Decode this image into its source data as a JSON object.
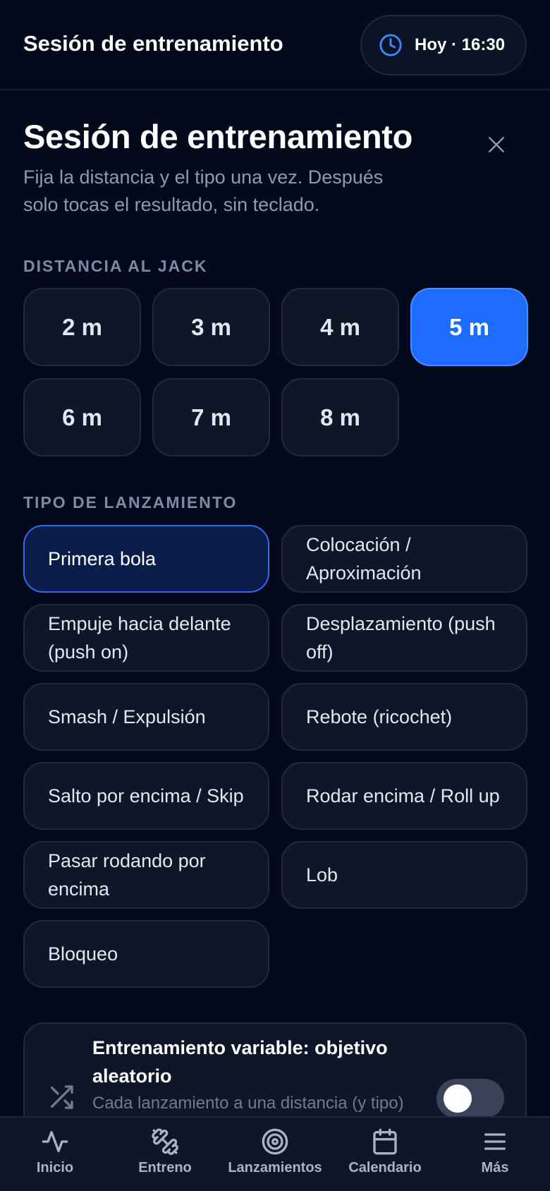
{
  "topbar": {
    "title": "Sesión de entrenamiento",
    "time_label": "Hoy · 16:30"
  },
  "header": {
    "title": "Sesión de entrenamiento",
    "subtitle": "Fija la distancia y el tipo una vez. Después solo tocas el resultado, sin teclado."
  },
  "distance": {
    "label": "DISTANCIA AL JACK",
    "options": [
      "2 m",
      "3 m",
      "4 m",
      "5 m",
      "6 m",
      "7 m",
      "8 m"
    ],
    "selected": "5 m"
  },
  "throw_type": {
    "label": "TIPO DE LANZAMIENTO",
    "options": [
      "Primera bola",
      "Colocación / Aproximación",
      "Empuje hacia delante (push on)",
      "Desplazamiento (push off)",
      "Smash / Expulsión",
      "Rebote (ricochet)",
      "Salto por encima / Skip",
      "Rodar encima / Roll up",
      "Pasar rodando por encima",
      "Lob",
      "Bloqueo"
    ],
    "selected": "Primera bola"
  },
  "variable_training": {
    "title": "Entrenamiento variable: objetivo aleatorio",
    "description": "Cada lanzamiento a una distancia (y tipo) distinta del grupo. Más difícil en el",
    "enabled": false,
    "icon": "shuffle-icon"
  },
  "nav": {
    "items": [
      {
        "label": "Inicio",
        "icon": "activity-icon"
      },
      {
        "label": "Entreno",
        "icon": "dumbbell-icon"
      },
      {
        "label": "Lanzamientos",
        "icon": "target-icon"
      },
      {
        "label": "Calendario",
        "icon": "calendar-icon"
      },
      {
        "label": "Más",
        "icon": "menu-icon"
      }
    ]
  },
  "colors": {
    "background": "#040A1C",
    "accent": "#1E6BFF",
    "selected_chip": "#0A1C4A"
  }
}
